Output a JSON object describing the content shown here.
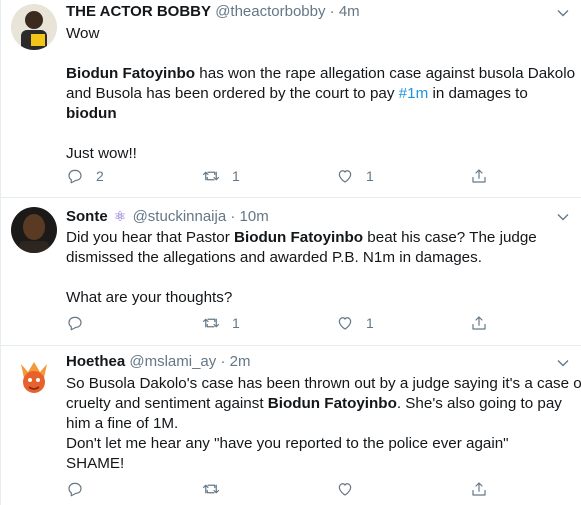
{
  "tweets": [
    {
      "name": "THE ACTOR BOBBY",
      "handle": "@theactorbobby",
      "sep": "·",
      "time": "4m",
      "lines": [
        [
          {
            "t": "Wow"
          }
        ],
        [],
        [
          {
            "t": "Biodun Fatoyinbo",
            "b": true
          },
          {
            "t": " has won the rape allegation case against busola Dakolo"
          }
        ],
        [
          {
            "t": "and Busola has been ordered by the court to pay "
          },
          {
            "t": "#1m",
            "h": true
          },
          {
            "t": " in damages to"
          }
        ],
        [
          {
            "t": "biodun",
            "b": true
          }
        ],
        [],
        [
          {
            "t": "Just wow!!"
          }
        ]
      ],
      "reply_count": "2",
      "retweet_count": "1",
      "like_count": "1"
    },
    {
      "name": "Sonte",
      "badge": "⚛",
      "handle": "@stuckinnaija",
      "sep": "·",
      "time": "10m",
      "lines": [
        [
          {
            "t": "Did you hear that Pastor "
          },
          {
            "t": "Biodun Fatoyinbo",
            "b": true
          },
          {
            "t": " beat his case? The judge"
          }
        ],
        [
          {
            "t": "dismissed the allegations and awarded P.B. N1m in damages."
          }
        ],
        [],
        [
          {
            "t": "What are your thoughts?"
          }
        ]
      ],
      "reply_count": "",
      "retweet_count": "1",
      "like_count": "1"
    },
    {
      "name": "Hoethea",
      "handle": "@mslami_ay",
      "sep": "·",
      "time": "2m",
      "lines": [
        [
          {
            "t": "So Busola Dakolo's case has been thrown out by a judge saying it's a case of"
          }
        ],
        [
          {
            "t": "cruelty and sentiment against "
          },
          {
            "t": "Biodun Fatoyinbo",
            "b": true
          },
          {
            "t": ". She's also going to pay"
          }
        ],
        [
          {
            "t": "him a fine of 1M."
          }
        ],
        [
          {
            "t": "Don't let me hear any \"have you reported to the police ever again\""
          }
        ],
        [
          {
            "t": "SHAME!"
          }
        ]
      ],
      "reply_count": "",
      "retweet_count": "",
      "like_count": ""
    }
  ],
  "colors": {
    "text": "#14171a",
    "secondary": "#657786",
    "link": "#1b95e0",
    "border": "#e6ecf0"
  }
}
